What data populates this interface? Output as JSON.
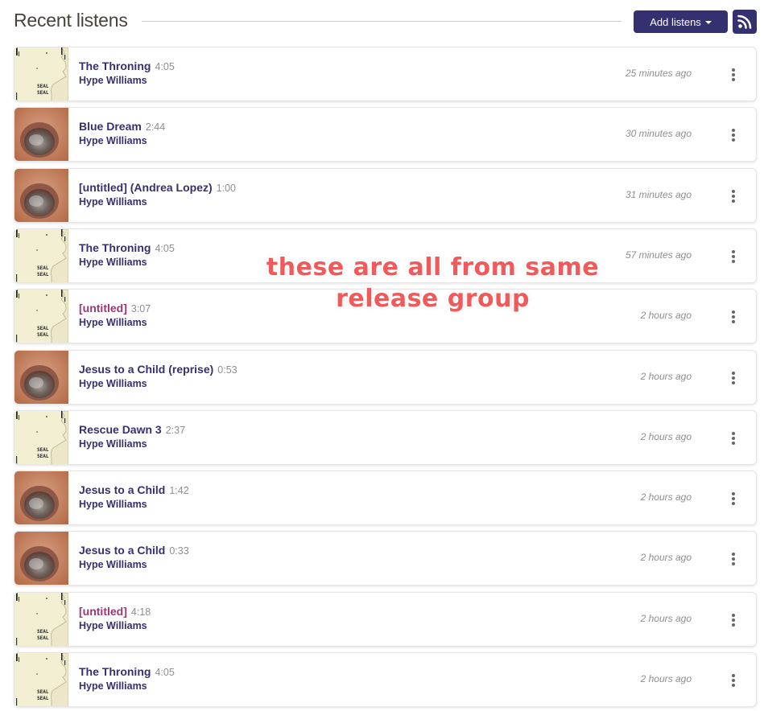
{
  "header": {
    "title": "Recent listens",
    "add_button_label": "Add listens",
    "rss_icon": "rss-icon"
  },
  "listens": [
    {
      "title": "The Throning",
      "duration": "4:05",
      "artist": "Hype Williams",
      "time": "25 minutes ago",
      "cover": "seal",
      "highlight": false
    },
    {
      "title": "Blue Dream",
      "duration": "2:44",
      "artist": "Hype Williams",
      "time": "30 minutes ago",
      "cover": "mouth",
      "highlight": false
    },
    {
      "title": "[untitled] (Andrea Lopez)",
      "duration": "1:00",
      "artist": "Hype Williams",
      "time": "31 minutes ago",
      "cover": "mouth",
      "highlight": false
    },
    {
      "title": "The Throning",
      "duration": "4:05",
      "artist": "Hype Williams",
      "time": "57 minutes ago",
      "cover": "seal",
      "highlight": false
    },
    {
      "title": "[untitled]",
      "duration": "3:07",
      "artist": "Hype Williams",
      "time": "2 hours ago",
      "cover": "seal",
      "highlight": true
    },
    {
      "title": "Jesus to a Child (reprise)",
      "duration": "0:53",
      "artist": "Hype Williams",
      "time": "2 hours ago",
      "cover": "mouth",
      "highlight": false
    },
    {
      "title": "Rescue Dawn 3",
      "duration": "2:37",
      "artist": "Hype Williams",
      "time": "2 hours ago",
      "cover": "seal",
      "highlight": false
    },
    {
      "title": "Jesus to a Child",
      "duration": "1:42",
      "artist": "Hype Williams",
      "time": "2 hours ago",
      "cover": "mouth",
      "highlight": false
    },
    {
      "title": "Jesus to a Child",
      "duration": "0:33",
      "artist": "Hype Williams",
      "time": "2 hours ago",
      "cover": "mouth",
      "highlight": false
    },
    {
      "title": "[untitled]",
      "duration": "4:18",
      "artist": "Hype Williams",
      "time": "2 hours ago",
      "cover": "seal",
      "highlight": true
    },
    {
      "title": "The Throning",
      "duration": "4:05",
      "artist": "Hype Williams",
      "time": "2 hours ago",
      "cover": "seal",
      "highlight": false
    }
  ],
  "cover_text": {
    "seal": [
      "SEAL",
      "SEAL"
    ]
  },
  "annotation": {
    "line1": "these are all from same",
    "line2": "release group",
    "color": "#f15a5a"
  },
  "colors": {
    "brand": "#353070",
    "highlight": "#9b3675"
  }
}
